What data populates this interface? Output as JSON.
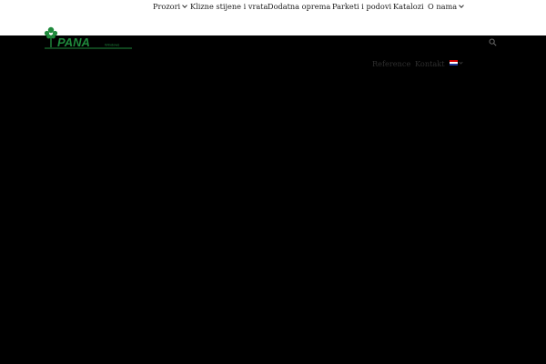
{
  "brand": {
    "logo_text": "PANA",
    "logo_subtext": "Windows",
    "logo_color": "#1f8a3c"
  },
  "menu": {
    "items": [
      {
        "label": "Prozori",
        "has_dropdown": true
      },
      {
        "label": "Klizne stijene i vrata",
        "has_dropdown": false
      },
      {
        "label": "Dodatna oprema",
        "has_dropdown": false
      },
      {
        "label": "Parketi i podovi",
        "has_dropdown": false
      },
      {
        "label": "Katalozi",
        "has_dropdown": false
      },
      {
        "label": "O nama",
        "has_dropdown": true
      }
    ]
  },
  "secondary_menu": {
    "items": [
      {
        "label": "Reference"
      },
      {
        "label": "Kontakt"
      }
    ],
    "language_icon": "croatia-flag-icon"
  },
  "icons": {
    "search": "search-icon"
  },
  "colors": {
    "header_bg": "#ffffff",
    "page_bg": "#000000",
    "menu_text": "#1a1a1a",
    "secondary_text": "#2f2f2f"
  }
}
